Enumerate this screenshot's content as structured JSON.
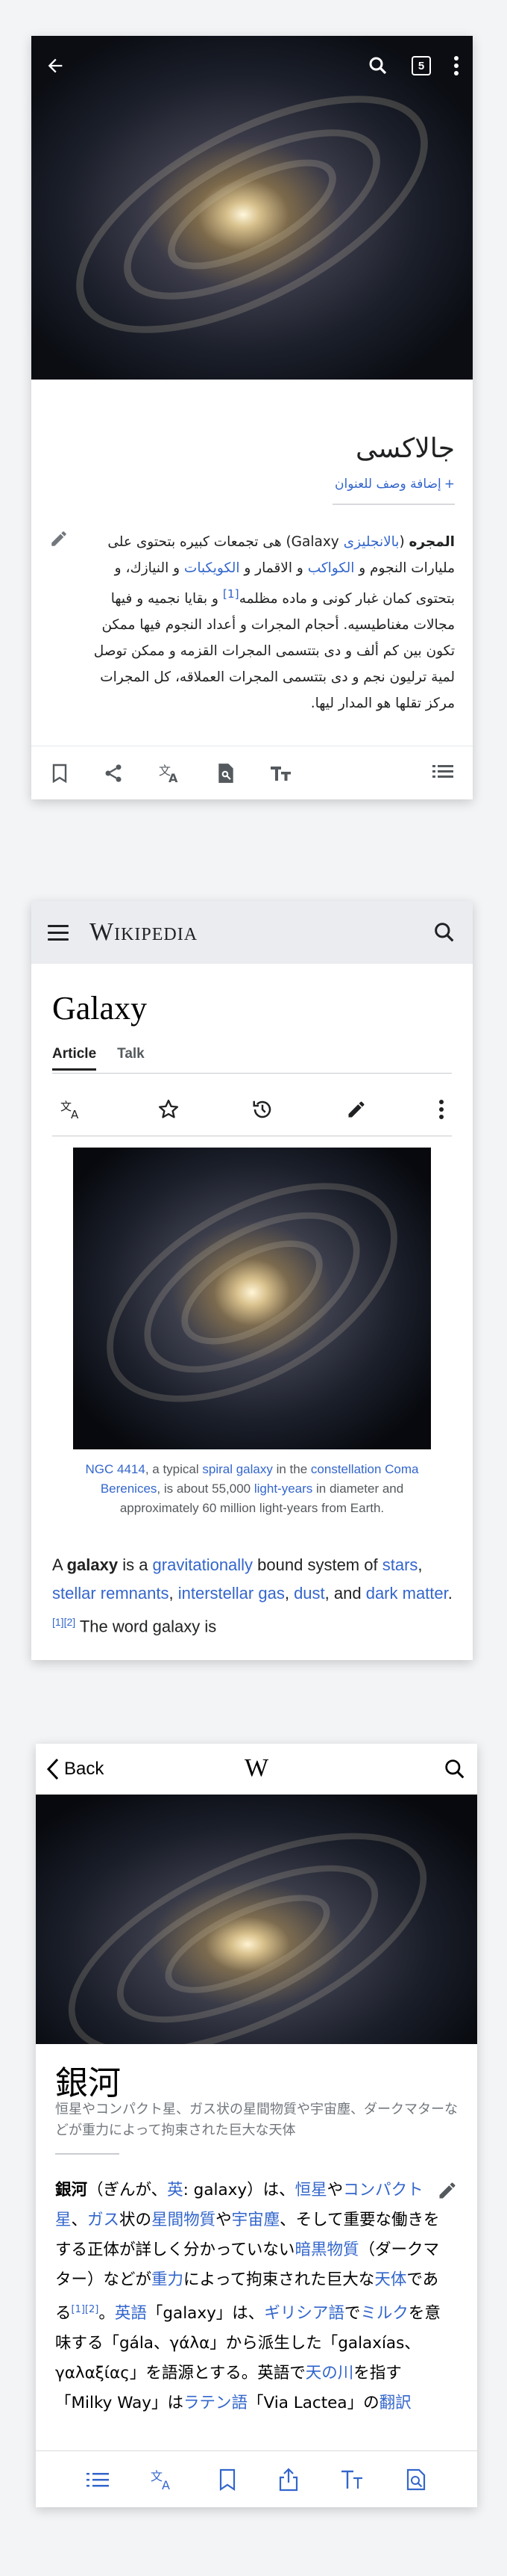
{
  "card1": {
    "tab_count": "5",
    "title": "جالاكسى",
    "add_description": "إضافة وصف للعنوان",
    "body": {
      "bold": "المجره",
      "p1": " (",
      "lang_link": "بالانجليزى",
      "p2": " Galaxy) هى تجمعات كبيره بتحتوى على مليارات النجوم و ",
      "planets_link": "الكواكب",
      "p3": " و الاقمار و ",
      "comets_link": "الكويكبات",
      "p4": " و النيازك، و بتحتوى كمان غبار كونى و ماده مظلمه",
      "ref": "[1]",
      "p5": " و بقايا نجميه و فيها مجالات مغناطيسيه. أحجام المجرات و أعداد النجوم فيها ممكن تكون بين كم ألف و دى بتتسمى المجرات القزمه و ممكن توصل لمية ترليون نجم و دى بتتسمى المجرات العملاقه، كل المجرات مركز تقلها هو المدار ليها."
    }
  },
  "card2": {
    "wordmark": "Wikipedia",
    "title": "Galaxy",
    "tabs": [
      "Article",
      "Talk"
    ],
    "caption": {
      "link1": "NGC 4414",
      "t1": ", a typical ",
      "link2": "spiral galaxy",
      "t2": " in the ",
      "link3": "constellation Coma Berenices",
      "t3": ", is about 55,000 ",
      "link4": "light-years",
      "t4": " in diameter and approximately 60 million light-years from Earth."
    },
    "body": {
      "t0": "A ",
      "bold": "galaxy",
      "t1": " is a ",
      "l1": "gravitationally",
      "t2": " bound system of ",
      "l2": "stars",
      "t3": ", ",
      "l3": "stellar remnants",
      "t4": ", ",
      "l4": "interstellar gas",
      "t5": ", ",
      "l5": "dust",
      "t6": ", and ",
      "l6": "dark matter",
      "t7": ".",
      "ref": "[1][2]",
      "t8": " The word galaxy is"
    }
  },
  "card3": {
    "back_label": "Back",
    "wordmark": "W",
    "title": "銀河",
    "description": "恒星やコンパクト星、ガス状の星間物質や宇宙塵、ダークマターなどが重力によって拘束された巨大な天体",
    "body": {
      "bold": "銀河",
      "t1": "（ぎんが、",
      "l1": "英",
      "t2": ": galaxy）は、",
      "l2": "恒星",
      "t3": "や",
      "l3": "コンパクト星",
      "t4": "、",
      "l4": "ガス",
      "t5": "状の",
      "l5": "星間物質",
      "t6": "や",
      "l6": "宇宙塵",
      "t7": "、そして重要な働きをする正体が詳しく分かっていない",
      "l7": "暗黒物質",
      "t8": "（ダークマター）などが",
      "l8": "重力",
      "t9": "によって拘束された巨大な",
      "l9": "天体",
      "t10": "である",
      "ref": "[1][2]",
      "t11": "。",
      "l10": "英語",
      "t12": "「galaxy」は、",
      "l11": "ギリシア語",
      "t13": "で",
      "l12": "ミルク",
      "t14": "を意味する「gála、γάλα」から派生した「galaxías、γαλαξίας」を語源とする。英語で",
      "l13": "天の川",
      "t15": "を指す「Milky Way」は",
      "l14": "ラテン語",
      "t16": "「Via Lactea」の",
      "l15": "翻訳"
    }
  }
}
